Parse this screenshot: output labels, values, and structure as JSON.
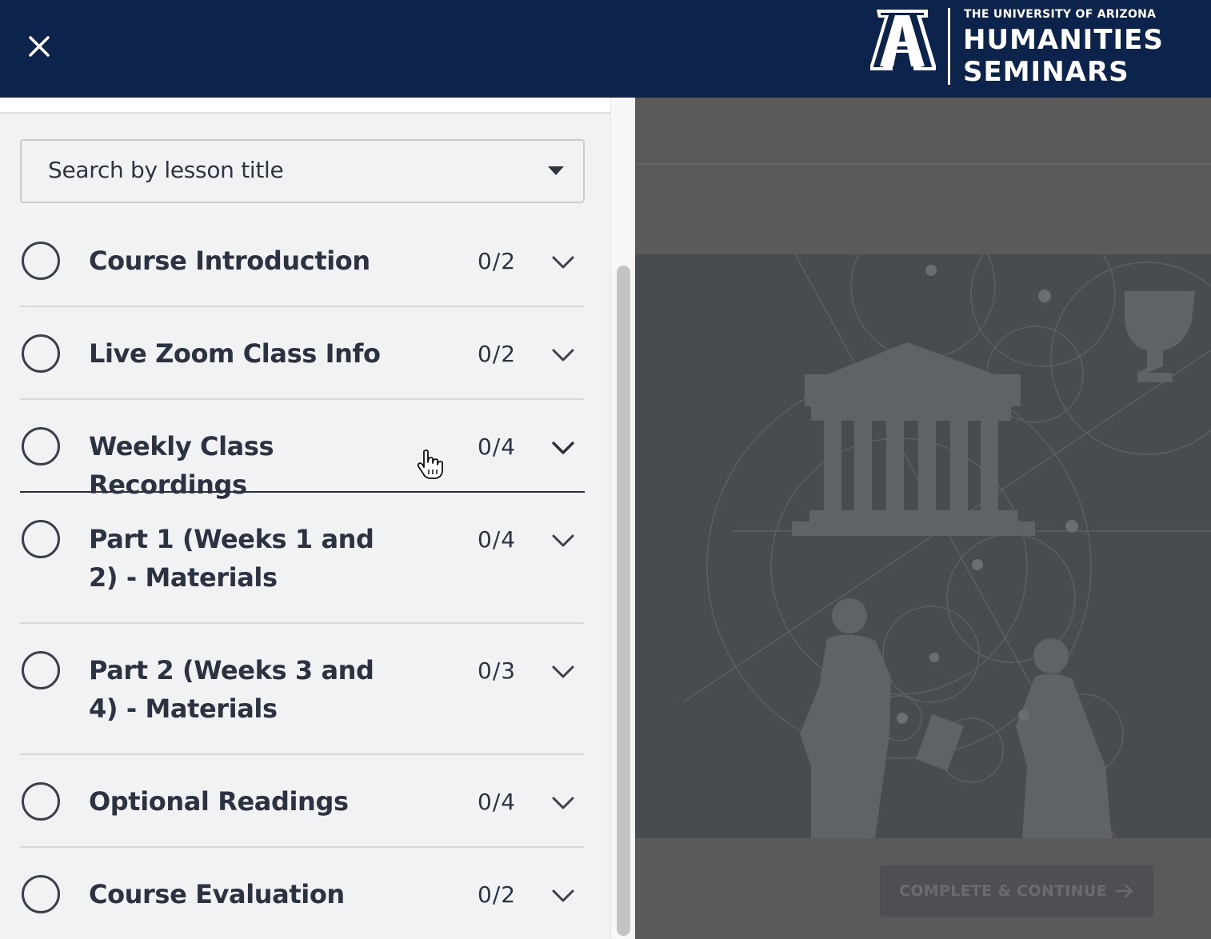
{
  "header": {
    "close_label": "Close",
    "logo": {
      "university": "THE UNIVERSITY OF ARIZONA",
      "line1": "HUMANITIES",
      "line2": "SEMINARS"
    }
  },
  "sidebar": {
    "search": {
      "placeholder": "Search by lesson title"
    },
    "sections": [
      {
        "title": "Course Introduction",
        "count": "0/2"
      },
      {
        "title": "Live Zoom Class Info",
        "count": "0/2"
      },
      {
        "title": "Weekly Class Recordings",
        "count": "0/4"
      },
      {
        "title": "Part 1 (Weeks 1 and 2) - Materials",
        "count": "0/4"
      },
      {
        "title": "Part 2 (Weeks 3 and 4) - Materials",
        "count": "0/3"
      },
      {
        "title": "Optional Readings",
        "count": "0/4"
      },
      {
        "title": "Course Evaluation",
        "count": "0/2"
      }
    ]
  },
  "main": {
    "complete_button": "COMPLETE & CONTINUE"
  },
  "colors": {
    "header_bg": "#0c234b",
    "sidebar_bg": "#f1f2f4",
    "overlay": "#5a5a5a"
  }
}
